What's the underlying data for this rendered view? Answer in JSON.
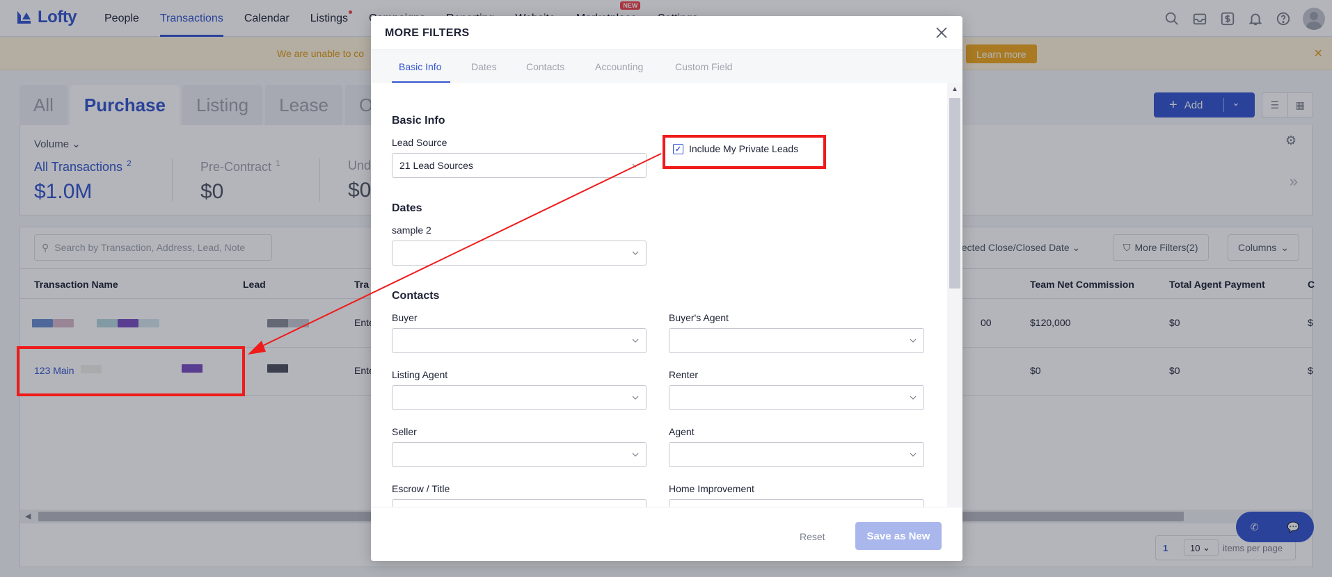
{
  "app": {
    "logo": "Lofty"
  },
  "nav": {
    "items": [
      {
        "label": "People"
      },
      {
        "label": "Transactions"
      },
      {
        "label": "Calendar"
      },
      {
        "label": "Listings"
      },
      {
        "label": "Campaigns"
      },
      {
        "label": "Reporting"
      },
      {
        "label": "Website"
      },
      {
        "label": "Marketplace"
      },
      {
        "label": "Settings"
      }
    ],
    "badge_new": "NEW",
    "icons": [
      "search-icon",
      "inbox-icon",
      "dollar-icon",
      "bell-icon",
      "help-icon",
      "avatar"
    ]
  },
  "banner": {
    "text": "We are unable to co",
    "learn_more": "Learn more"
  },
  "type_tabs": [
    "All",
    "Purchase",
    "Listing",
    "Lease",
    "O"
  ],
  "add_button": {
    "label": "Add"
  },
  "summary": {
    "volume_label": "Volume",
    "stats": [
      {
        "label": "All Transactions",
        "count": "2",
        "value": "$1.0M"
      },
      {
        "label": "Pre-Contract",
        "count": "1",
        "value": "$0"
      },
      {
        "label": "Und",
        "count": "",
        "value": "$0"
      }
    ]
  },
  "table": {
    "search_placeholder": "Search by Transaction, Address, Lead, Note",
    "date_filter": "pected Close/Closed Date",
    "more_filters": "More Filters(2)",
    "columns_btn": "Columns",
    "headers": {
      "name": "Transaction Name",
      "lead": "Lead",
      "type": "Tra",
      "team_net": "Team Net Commission",
      "agent_pay": "Total Agent Payment",
      "last": "C"
    },
    "rows": [
      {
        "name": "",
        "type": "Ente",
        "price": "00",
        "team_net": "$120,000",
        "agent_pay": "$0",
        "last": "$"
      },
      {
        "name": "123 Main",
        "type": "Ente",
        "price": "",
        "team_net": "$0",
        "agent_pay": "$0",
        "last": "$"
      }
    ],
    "pager": {
      "page": "1",
      "per_page": "10",
      "per_page_label": "items per page"
    }
  },
  "modal": {
    "title": "MORE FILTERS",
    "tabs": [
      "Basic Info",
      "Dates",
      "Contacts",
      "Accounting",
      "Custom Field"
    ],
    "basic_info": {
      "heading": "Basic Info",
      "lead_source_label": "Lead Source",
      "lead_source_value": "21 Lead Sources",
      "private_leads_label": "Include My Private Leads",
      "private_leads_checked": true
    },
    "dates": {
      "heading": "Dates",
      "sample_label": "sample 2",
      "sample_value": ""
    },
    "contacts": {
      "heading": "Contacts",
      "fields": [
        {
          "label": "Buyer",
          "value": ""
        },
        {
          "label": "Buyer's Agent",
          "value": ""
        },
        {
          "label": "Listing Agent",
          "value": ""
        },
        {
          "label": "Renter",
          "value": ""
        },
        {
          "label": "Seller",
          "value": ""
        },
        {
          "label": "Agent",
          "value": ""
        },
        {
          "label": "Escrow / Title",
          "value": ""
        },
        {
          "label": "Home Improvement",
          "value": ""
        }
      ]
    },
    "footer": {
      "reset": "Reset",
      "save": "Save as New"
    }
  },
  "colors": {
    "brand": "#3556ce",
    "annotation": "#ef1b1b",
    "banner_text": "#e29a10"
  }
}
